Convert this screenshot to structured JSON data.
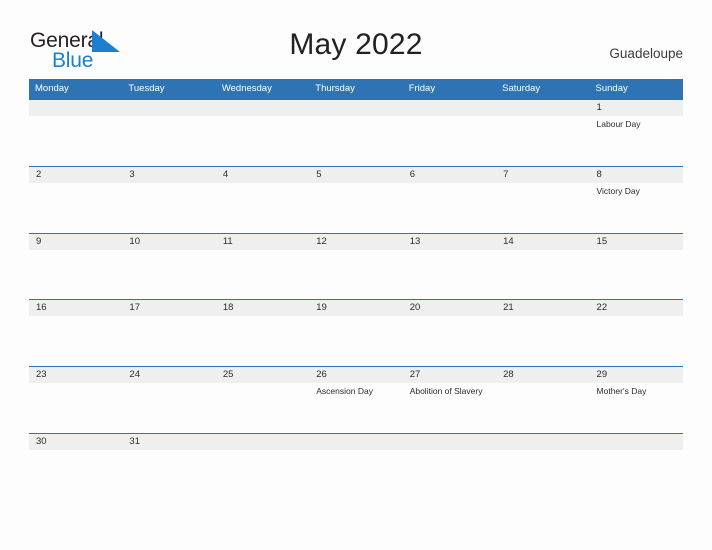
{
  "brand": {
    "word_one": "General",
    "word_two": "Blue",
    "flag_icon": "blue-flag-triangle-icon",
    "color_dark": "#231f20",
    "color_blue": "#1c7fd0"
  },
  "header": {
    "title": "May 2022",
    "location": "Guadeloupe"
  },
  "theme": {
    "header_blue": "#2e74b5",
    "row_band_gray": "#efefef",
    "page_background": "#fdfdfd",
    "text_color": "#2b2b2b"
  },
  "calendar": {
    "day_headers": [
      "Monday",
      "Tuesday",
      "Wednesday",
      "Thursday",
      "Friday",
      "Saturday",
      "Sunday"
    ],
    "weeks": [
      {
        "days": [
          {
            "number": "",
            "event": ""
          },
          {
            "number": "",
            "event": ""
          },
          {
            "number": "",
            "event": ""
          },
          {
            "number": "",
            "event": ""
          },
          {
            "number": "",
            "event": ""
          },
          {
            "number": "",
            "event": ""
          },
          {
            "number": "1",
            "event": "Labour Day"
          }
        ]
      },
      {
        "days": [
          {
            "number": "2",
            "event": ""
          },
          {
            "number": "3",
            "event": ""
          },
          {
            "number": "4",
            "event": ""
          },
          {
            "number": "5",
            "event": ""
          },
          {
            "number": "6",
            "event": ""
          },
          {
            "number": "7",
            "event": ""
          },
          {
            "number": "8",
            "event": "Victory Day"
          }
        ]
      },
      {
        "days": [
          {
            "number": "9",
            "event": ""
          },
          {
            "number": "10",
            "event": ""
          },
          {
            "number": "11",
            "event": ""
          },
          {
            "number": "12",
            "event": ""
          },
          {
            "number": "13",
            "event": ""
          },
          {
            "number": "14",
            "event": ""
          },
          {
            "number": "15",
            "event": ""
          }
        ]
      },
      {
        "days": [
          {
            "number": "16",
            "event": ""
          },
          {
            "number": "17",
            "event": ""
          },
          {
            "number": "18",
            "event": ""
          },
          {
            "number": "19",
            "event": ""
          },
          {
            "number": "20",
            "event": ""
          },
          {
            "number": "21",
            "event": ""
          },
          {
            "number": "22",
            "event": ""
          }
        ]
      },
      {
        "days": [
          {
            "number": "23",
            "event": ""
          },
          {
            "number": "24",
            "event": ""
          },
          {
            "number": "25",
            "event": ""
          },
          {
            "number": "26",
            "event": "Ascension Day"
          },
          {
            "number": "27",
            "event": "Abolition of Slavery"
          },
          {
            "number": "28",
            "event": ""
          },
          {
            "number": "29",
            "event": "Mother's Day"
          }
        ]
      },
      {
        "days": [
          {
            "number": "30",
            "event": ""
          },
          {
            "number": "31",
            "event": ""
          },
          {
            "number": "",
            "event": ""
          },
          {
            "number": "",
            "event": ""
          },
          {
            "number": "",
            "event": ""
          },
          {
            "number": "",
            "event": ""
          },
          {
            "number": "",
            "event": ""
          }
        ]
      }
    ]
  }
}
